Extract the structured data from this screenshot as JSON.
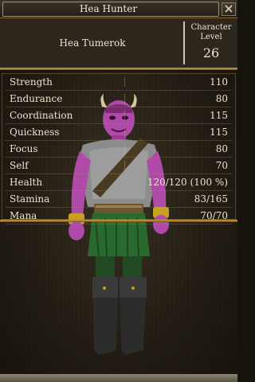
{
  "window": {
    "title": "Hea Hunter"
  },
  "header": {
    "character_name": "Hea Tumerok",
    "level_label": "Character Level",
    "level_value": "26"
  },
  "stats": [
    {
      "label": "Strength",
      "value": "110"
    },
    {
      "label": "Endurance",
      "value": "80"
    },
    {
      "label": "Coordination",
      "value": "115"
    },
    {
      "label": "Quickness",
      "value": "115"
    },
    {
      "label": "Focus",
      "value": "80"
    },
    {
      "label": "Self",
      "value": "70"
    },
    {
      "label": "Health",
      "value": "120/120 (100 %)"
    },
    {
      "label": "Stamina",
      "value": "83/165"
    },
    {
      "label": "Mana",
      "value": "70/70"
    }
  ],
  "icons": {
    "close": "close-icon"
  }
}
